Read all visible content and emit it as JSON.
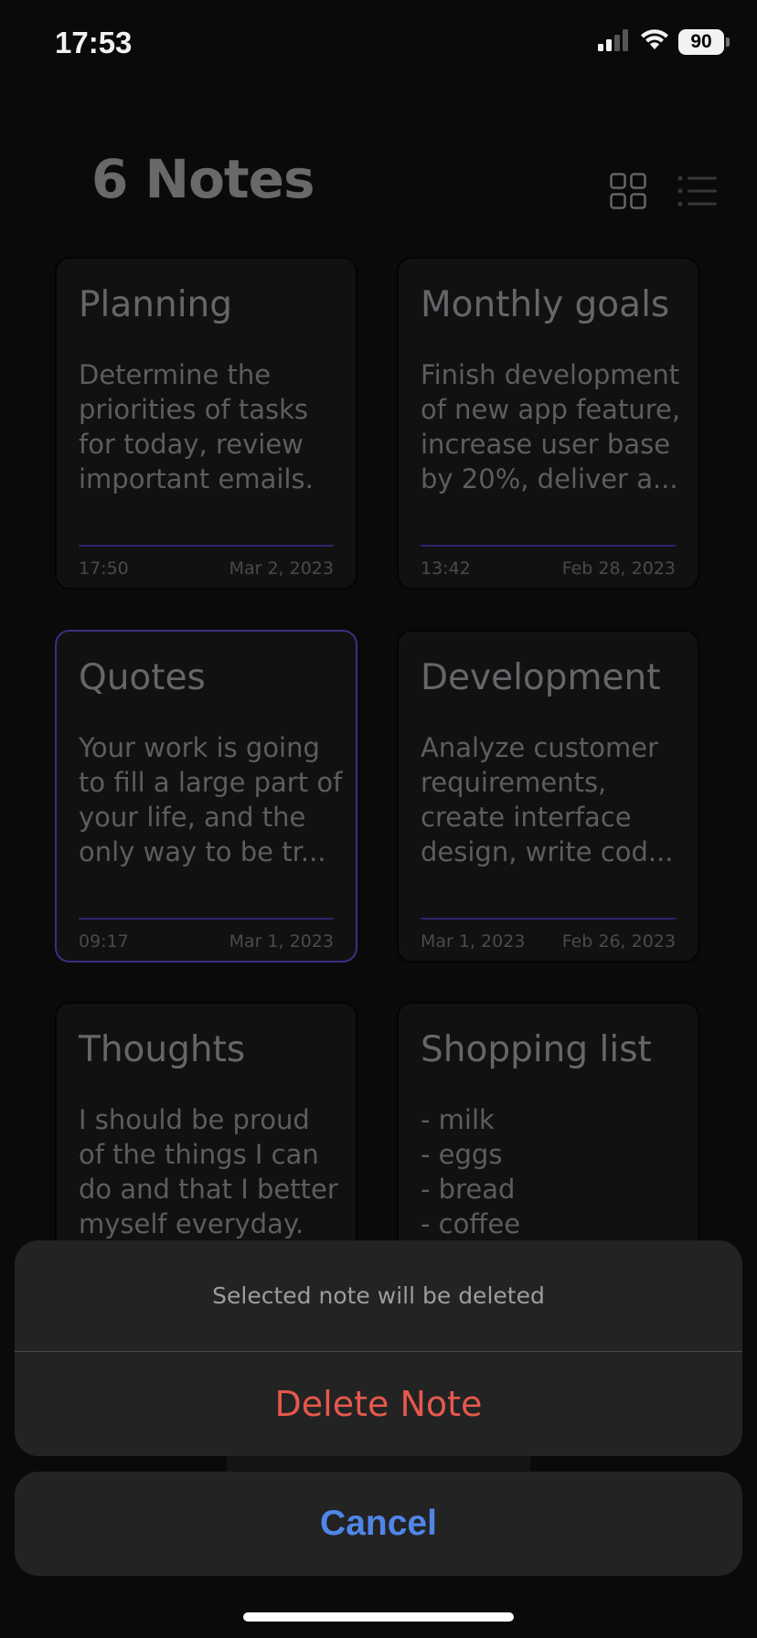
{
  "status_bar": {
    "time": "17:53",
    "battery": "90",
    "icons": [
      "cellular-signal-icon",
      "wifi-icon",
      "battery-icon"
    ]
  },
  "header": {
    "title": "6 Notes",
    "view_modes": [
      "grid-view-icon",
      "list-view-icon"
    ],
    "active_view": "grid"
  },
  "notes": [
    {
      "title": "Planning",
      "body": "Determine the\npriorities of tasks\nfor today, review\nimportant emails.",
      "time": "17:50",
      "date": "Mar 2, 2023",
      "selected": false
    },
    {
      "title": "Monthly goals",
      "body": "Finish development\nof new app feature,\nincrease user base\nby 20%, deliver a...",
      "time": "13:42",
      "date": "Feb 28, 2023",
      "selected": false
    },
    {
      "title": "Quotes",
      "body": "Your work is going\nto fill a large part of\nyour life, and the\nonly way to be tr...",
      "time": "09:17",
      "date": "Mar 1, 2023",
      "selected": true
    },
    {
      "title": "Development",
      "body": "Analyze customer\nrequirements,\ncreate interface\ndesign, write cod...",
      "time": "Mar 1, 2023",
      "date": "Feb 26, 2023",
      "selected": false
    },
    {
      "title": "Thoughts",
      "body": "I should be proud\nof the things I can\ndo and that I better\nmyself everyday.",
      "time": "",
      "date": "",
      "selected": false
    },
    {
      "title": "Shopping list",
      "body": "- milk\n- eggs\n- bread\n- coffee",
      "time": "",
      "date": "",
      "selected": false
    }
  ],
  "action_sheet": {
    "message": "Selected note will be deleted",
    "delete_label": "Delete Note",
    "cancel_label": "Cancel"
  },
  "colors": {
    "background": "#0b0b0c",
    "card": "#121213",
    "selected_border": "#3c3488",
    "divider": "#2c2773",
    "destructive": "#e5594b",
    "cancel": "#4f86e8"
  }
}
